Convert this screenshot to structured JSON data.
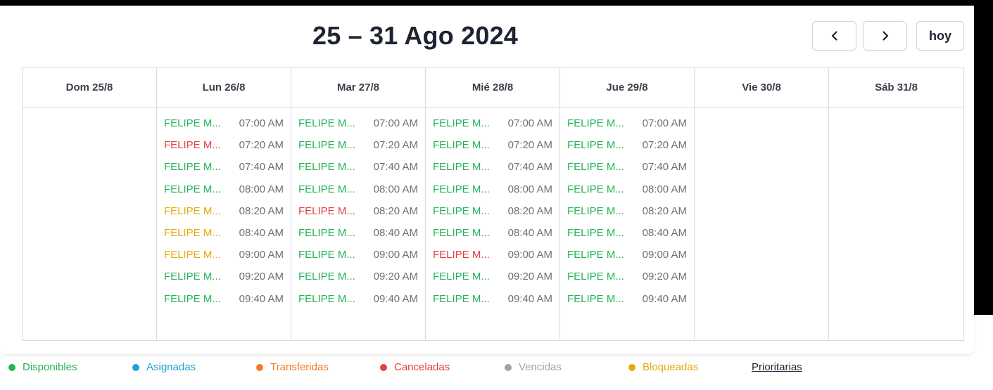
{
  "header": {
    "title": "25 – 31 Ago 2024",
    "prev_icon": "chevron-left-icon",
    "next_icon": "chevron-right-icon",
    "today_label": "hoy"
  },
  "status_colors": {
    "available": "#22b356",
    "assigned": "#1f9fd9",
    "transferred": "#f47a24",
    "cancelled": "#e53e3e",
    "expired": "#9fa3a8",
    "blocked": "#e8a90c"
  },
  "days": [
    {
      "label": "Dom 25/8",
      "slots": []
    },
    {
      "label": "Lun 26/8",
      "slots": [
        {
          "name": "FELIPE M...",
          "time": "07:00 AM",
          "status": "available"
        },
        {
          "name": "FELIPE M...",
          "time": "07:20 AM",
          "status": "cancelled"
        },
        {
          "name": "FELIPE M...",
          "time": "07:40 AM",
          "status": "available"
        },
        {
          "name": "FELIPE M...",
          "time": "08:00 AM",
          "status": "available"
        },
        {
          "name": "FELIPE M...",
          "time": "08:20 AM",
          "status": "blocked"
        },
        {
          "name": "FELIPE M...",
          "time": "08:40 AM",
          "status": "blocked"
        },
        {
          "name": "FELIPE M...",
          "time": "09:00 AM",
          "status": "blocked"
        },
        {
          "name": "FELIPE M...",
          "time": "09:20 AM",
          "status": "available"
        },
        {
          "name": "FELIPE M...",
          "time": "09:40 AM",
          "status": "available"
        }
      ]
    },
    {
      "label": "Mar 27/8",
      "slots": [
        {
          "name": "FELIPE M...",
          "time": "07:00 AM",
          "status": "available"
        },
        {
          "name": "FELIPE M...",
          "time": "07:20 AM",
          "status": "available"
        },
        {
          "name": "FELIPE M...",
          "time": "07:40 AM",
          "status": "available"
        },
        {
          "name": "FELIPE M...",
          "time": "08:00 AM",
          "status": "available"
        },
        {
          "name": "FELIPE M...",
          "time": "08:20 AM",
          "status": "cancelled"
        },
        {
          "name": "FELIPE M...",
          "time": "08:40 AM",
          "status": "available"
        },
        {
          "name": "FELIPE M...",
          "time": "09:00 AM",
          "status": "available"
        },
        {
          "name": "FELIPE M...",
          "time": "09:20 AM",
          "status": "available"
        },
        {
          "name": "FELIPE M...",
          "time": "09:40 AM",
          "status": "available"
        }
      ]
    },
    {
      "label": "Mié 28/8",
      "slots": [
        {
          "name": "FELIPE M...",
          "time": "07:00 AM",
          "status": "available"
        },
        {
          "name": "FELIPE M...",
          "time": "07:20 AM",
          "status": "available"
        },
        {
          "name": "FELIPE M...",
          "time": "07:40 AM",
          "status": "available"
        },
        {
          "name": "FELIPE M...",
          "time": "08:00 AM",
          "status": "available"
        },
        {
          "name": "FELIPE M...",
          "time": "08:20 AM",
          "status": "available"
        },
        {
          "name": "FELIPE M...",
          "time": "08:40 AM",
          "status": "available"
        },
        {
          "name": "FELIPE M...",
          "time": "09:00 AM",
          "status": "cancelled"
        },
        {
          "name": "FELIPE M...",
          "time": "09:20 AM",
          "status": "available"
        },
        {
          "name": "FELIPE M...",
          "time": "09:40 AM",
          "status": "available"
        }
      ]
    },
    {
      "label": "Jue 29/8",
      "slots": [
        {
          "name": "FELIPE M...",
          "time": "07:00 AM",
          "status": "available"
        },
        {
          "name": "FELIPE M...",
          "time": "07:20 AM",
          "status": "available"
        },
        {
          "name": "FELIPE M...",
          "time": "07:40 AM",
          "status": "available"
        },
        {
          "name": "FELIPE M...",
          "time": "08:00 AM",
          "status": "available"
        },
        {
          "name": "FELIPE M...",
          "time": "08:20 AM",
          "status": "available"
        },
        {
          "name": "FELIPE M...",
          "time": "08:40 AM",
          "status": "available"
        },
        {
          "name": "FELIPE M...",
          "time": "09:00 AM",
          "status": "available"
        },
        {
          "name": "FELIPE M...",
          "time": "09:20 AM",
          "status": "available"
        },
        {
          "name": "FELIPE M...",
          "time": "09:40 AM",
          "status": "available"
        }
      ]
    },
    {
      "label": "Vie 30/8",
      "slots": []
    },
    {
      "label": "Sáb 31/8",
      "slots": []
    }
  ],
  "legend": [
    {
      "label": "Disponibles",
      "status": "available"
    },
    {
      "label": "Asignadas",
      "status": "assigned"
    },
    {
      "label": "Transferidas",
      "status": "transferred"
    },
    {
      "label": "Canceladas",
      "status": "cancelled"
    },
    {
      "label": "Vencidas",
      "status": "expired"
    },
    {
      "label": "Bloqueadas",
      "status": "blocked"
    }
  ],
  "legend_priority_label": "Prioritarias"
}
